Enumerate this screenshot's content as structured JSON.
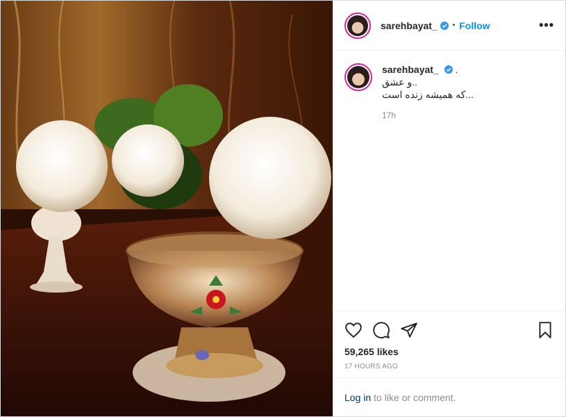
{
  "post": {
    "username": "sarehbayat_",
    "follow_label": "Follow",
    "more_label": "•••",
    "caption_lines": [
      ".",
      "..و عشق",
      "...که همیشه زنده است"
    ],
    "caption_time": "17h",
    "likes": "59,265 likes",
    "posted_ago": "17 HOURS AGO"
  },
  "login": {
    "link_label": "Log in",
    "rest_label": "to like or comment."
  },
  "colors": {
    "follow": "#0095f6",
    "verified": "#3897f0",
    "meta_grey": "#8e8e8e"
  },
  "icons": [
    "heart-icon",
    "comment-icon",
    "share-icon",
    "bookmark-icon",
    "more-icon",
    "verified-badge-icon"
  ]
}
